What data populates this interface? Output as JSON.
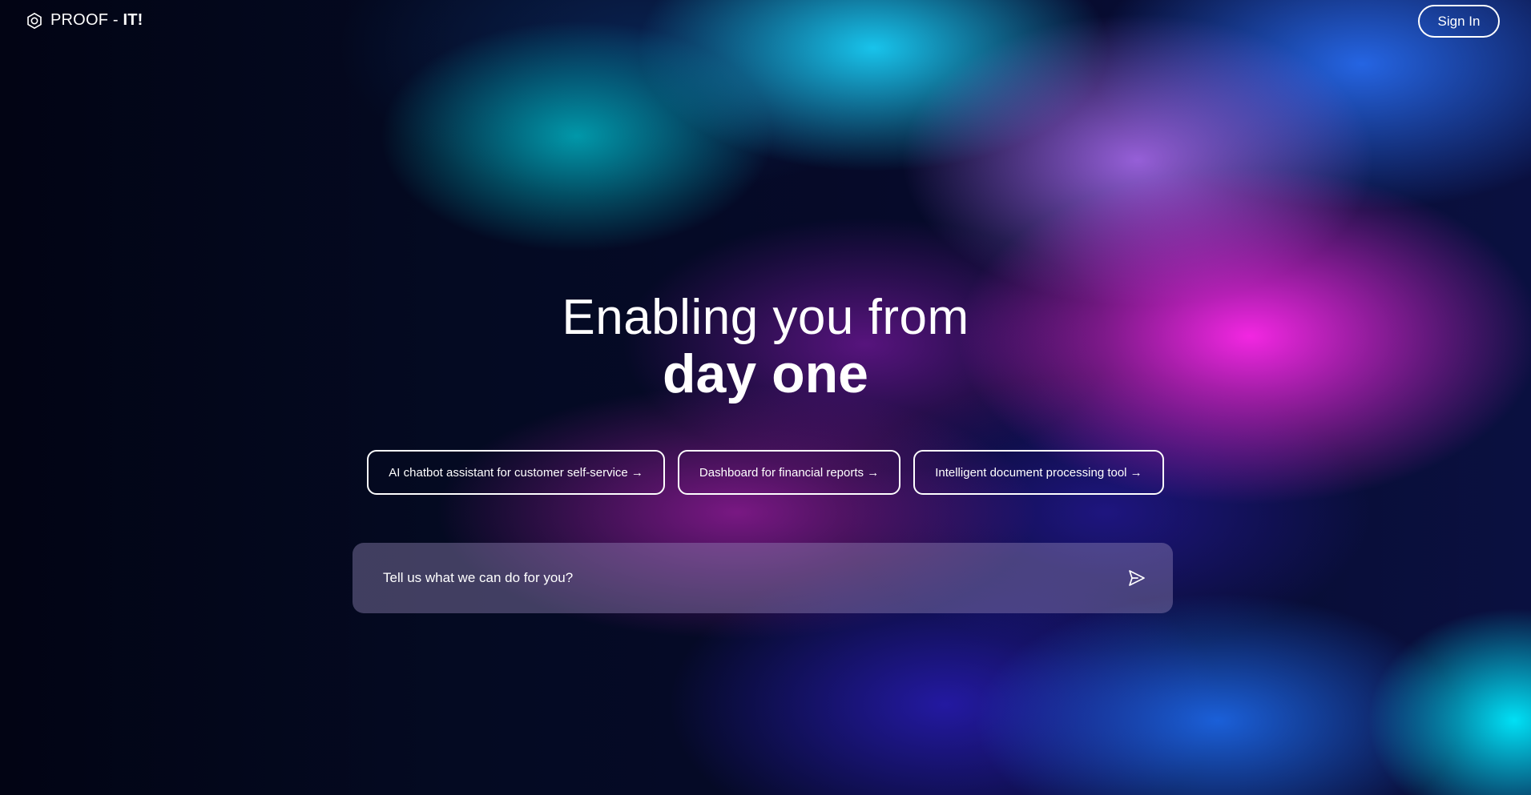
{
  "header": {
    "logo_icon": "hexagon-target-icon",
    "brand_prefix": "PROOF - ",
    "brand_suffix": "IT!",
    "sign_in_label": "Sign In"
  },
  "hero": {
    "line1": "Enabling you from",
    "line2": "day one"
  },
  "suggestions": [
    {
      "label": "AI chatbot assistant for customer self-service →"
    },
    {
      "label": "Dashboard for financial reports →"
    },
    {
      "label": "Intelligent document processing tool →"
    }
  ],
  "prompt": {
    "placeholder": "Tell us what we can do for you?",
    "send_icon": "send-icon"
  },
  "colors": {
    "text": "#ffffff",
    "background_dark": "#030418",
    "accent_magenta": "#ff28eb",
    "accent_cyan": "#19cdf5",
    "accent_blue": "#286ef5"
  }
}
